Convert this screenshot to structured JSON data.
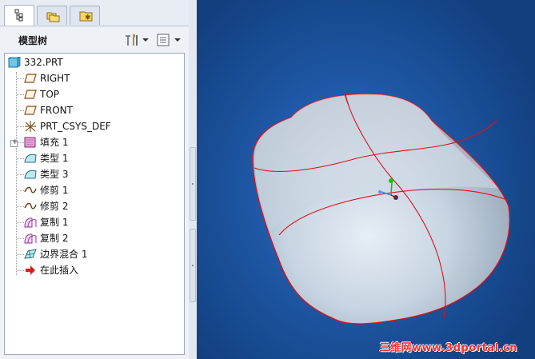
{
  "tabs": [
    {
      "name": "model-tree-tab",
      "icon": "model-tree-icon",
      "active": true
    },
    {
      "name": "layers-tab",
      "icon": "folders-icon",
      "active": false
    },
    {
      "name": "favorites-tab",
      "icon": "star-folder-icon",
      "active": false
    }
  ],
  "tree_header": {
    "title": "模型树",
    "settings_icon": "tools-settings-icon",
    "show_icon": "show-list-icon"
  },
  "model_tree": {
    "root": "332.PRT",
    "items": [
      {
        "label": "RIGHT",
        "icon": "datum-plane-icon"
      },
      {
        "label": "TOP",
        "icon": "datum-plane-icon"
      },
      {
        "label": "FRONT",
        "icon": "datum-plane-icon"
      },
      {
        "label": "PRT_CSYS_DEF",
        "icon": "coordinate-system-icon"
      },
      {
        "label": "填充 1",
        "icon": "fill-surface-icon"
      },
      {
        "label": "类型 1",
        "icon": "surface-type-icon"
      },
      {
        "label": "类型 3",
        "icon": "surface-type-icon"
      },
      {
        "label": "修剪 1",
        "icon": "trim-icon"
      },
      {
        "label": "修剪 2",
        "icon": "trim-icon"
      },
      {
        "label": "复制 1",
        "icon": "copy-surface-icon"
      },
      {
        "label": "复制 2",
        "icon": "copy-surface-icon"
      },
      {
        "label": "边界混合 1",
        "icon": "boundary-blend-icon"
      },
      {
        "label": "在此插入",
        "icon": "insert-here-arrow-icon"
      }
    ]
  },
  "viewport": {
    "watermark": "三维网www.3dportal.cn",
    "colors": {
      "background": "#1f58a6",
      "edge_lines": "#e0101a",
      "surface": "#c9d6e2"
    }
  }
}
